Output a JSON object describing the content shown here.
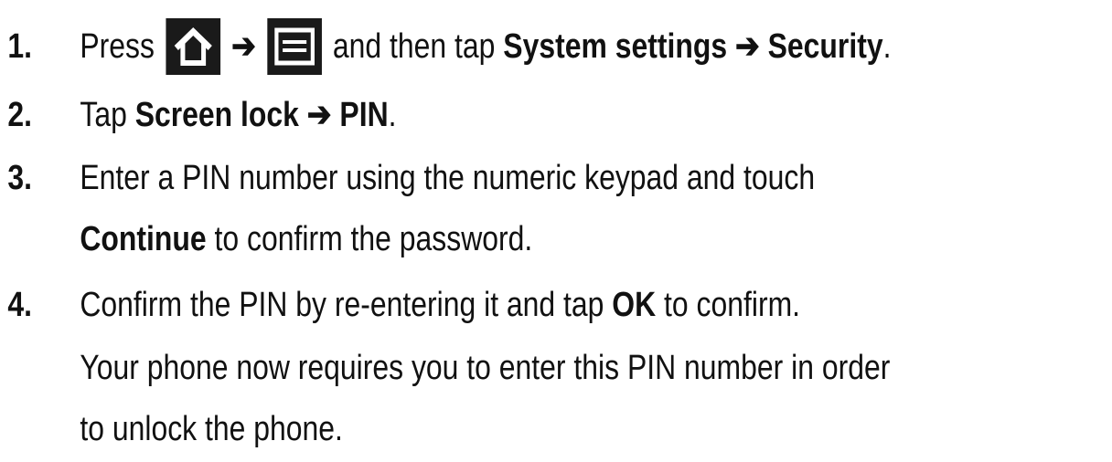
{
  "steps": [
    {
      "number": "1.",
      "t1": "Press",
      "home_icon": "home-icon",
      "arrow1": "➔",
      "menu_icon": "menu-icon",
      "t2": "and then tap",
      "b1": "System settings",
      "arrow2": "➔",
      "b2": "Security",
      "t3": "."
    },
    {
      "number": "2.",
      "t1": "Tap",
      "b1": "Screen lock",
      "arrow1": "➔",
      "b2": "PIN",
      "t2": "."
    },
    {
      "number": "3.",
      "line1": "Enter a PIN number using the numeric keypad and touch",
      "b1": "Continue",
      "line2": "to confirm the password."
    },
    {
      "number": "4.",
      "t1": "Confirm the PIN by re-entering it and tap",
      "b1": "OK",
      "t2": "to confirm."
    }
  ],
  "note": {
    "line1": "Your phone now requires you to enter this PIN number in order",
    "line2": "to unlock the phone."
  },
  "colors": {
    "text": "#111111",
    "key_background": "#1a1a1a",
    "key_foreground": "#ffffff"
  }
}
